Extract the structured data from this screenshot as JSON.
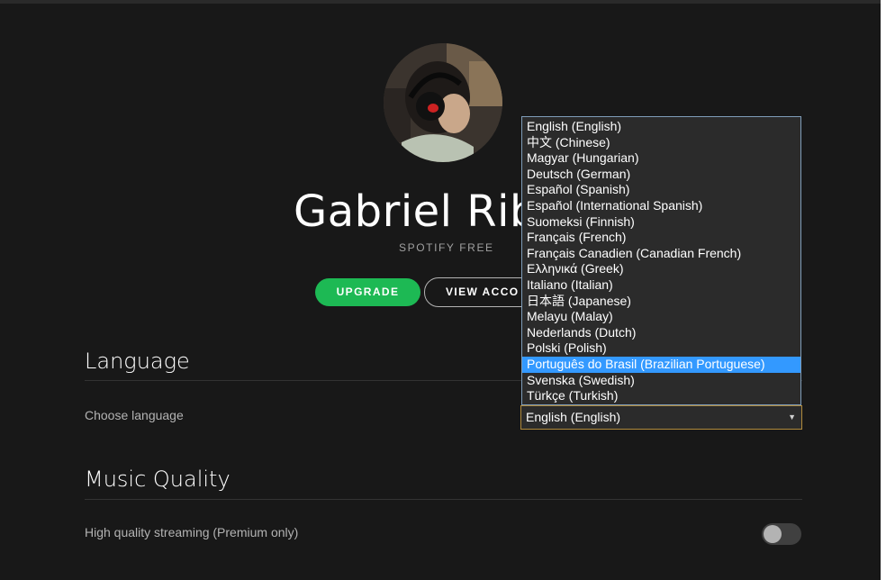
{
  "profile": {
    "name": "Gabriel Ribe",
    "plan": "SPOTIFY FREE",
    "upgrade_label": "UPGRADE",
    "account_label": "VIEW ACCO"
  },
  "language": {
    "section_title": "Language",
    "row_label": "Choose language",
    "selected_value": "English (English)",
    "highlighted_index": 15,
    "options": [
      "English (English)",
      "中文 (Chinese)",
      "Magyar (Hungarian)",
      "Deutsch (German)",
      "Español (Spanish)",
      "Español (International Spanish)",
      "Suomeksi (Finnish)",
      "Français (French)",
      "Français Canadien (Canadian French)",
      "Ελληνικά (Greek)",
      "Italiano (Italian)",
      "日本語 (Japanese)",
      "Melayu (Malay)",
      "Nederlands (Dutch)",
      "Polski (Polish)",
      "Português do Brasil (Brazilian Portuguese)",
      "Svenska (Swedish)",
      "Türkçe (Turkish)"
    ],
    "arrow_icon": "▼"
  },
  "music_quality": {
    "section_title": "Music Quality",
    "high_quality_label": "High quality streaming (Premium only)",
    "high_quality_enabled": false
  },
  "colors": {
    "background": "#181818",
    "accent_green": "#1db954",
    "dropdown_highlight": "#3399ff",
    "muted_text": "#b3b3b3"
  },
  "icons": {
    "avatar": "profile-photo",
    "select_arrow": "chevron-down-icon"
  }
}
